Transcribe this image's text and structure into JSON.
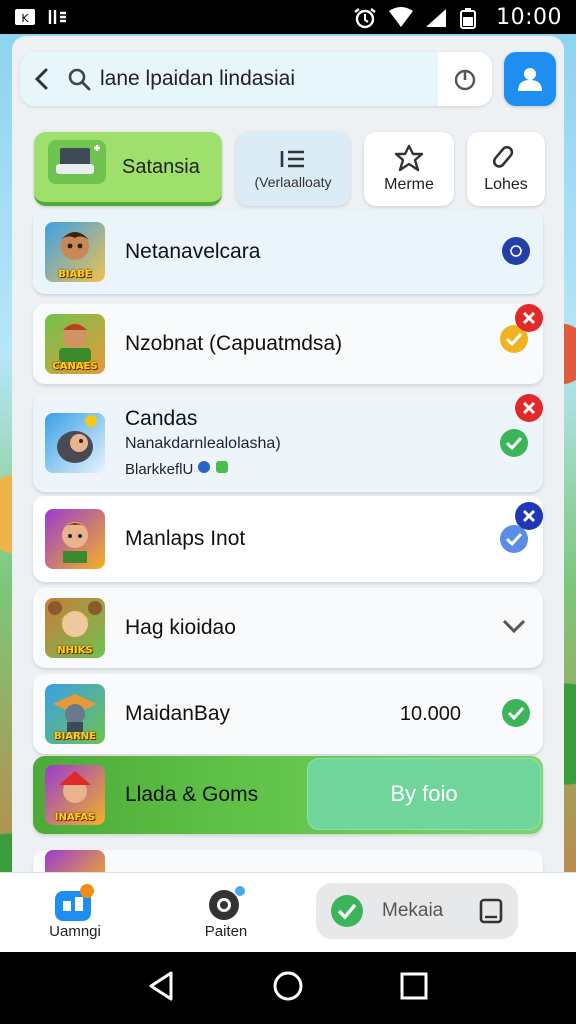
{
  "status_bar": {
    "time": "10:00"
  },
  "search": {
    "query": "lane lpaidan lindasiai"
  },
  "tabs": [
    {
      "label": "Satansia",
      "icon": "game-console-icon",
      "selected": true
    },
    {
      "label": "(Verlaalloaty",
      "icon": "list-icon",
      "selected": false
    },
    {
      "label": "Merme",
      "icon": "puzzle-icon",
      "selected": false
    },
    {
      "label": "Lohes",
      "icon": "tools-icon",
      "selected": false
    }
  ],
  "list": {
    "items": [
      {
        "title": "Netanavelcara",
        "thumb_label": "BIABE",
        "status": "info"
      },
      {
        "title": "Nzobnat (Capuatmdsa)",
        "thumb_label": "CANAES",
        "status": "pending-remove"
      },
      {
        "title": "Candas",
        "subtitle": "Nanakdarnlealolasha)",
        "meta": "BlarkkeflU",
        "status": "installed-remove"
      },
      {
        "title": "Manlaps Inot",
        "status": "selected-remove"
      },
      {
        "title": "Hag kioidao",
        "thumb_label": "NHIKS",
        "status": "expand"
      },
      {
        "title": "MaidanBay",
        "thumb_label": "BIARNE",
        "value": "10.000",
        "status": "installed"
      },
      {
        "title": "Llada & Goms",
        "thumb_label": "INAFAS",
        "button_label": "By foio",
        "status": "highlight"
      }
    ]
  },
  "bottom_nav": {
    "home_label": "Uamngi",
    "patten_label": "Paiten",
    "pill_label": "Mekaia"
  },
  "colors": {
    "accent_blue": "#1e8ff0",
    "accent_green": "#4daa3a",
    "check_green": "#3cb55a",
    "remove_red": "#e02a2a"
  }
}
